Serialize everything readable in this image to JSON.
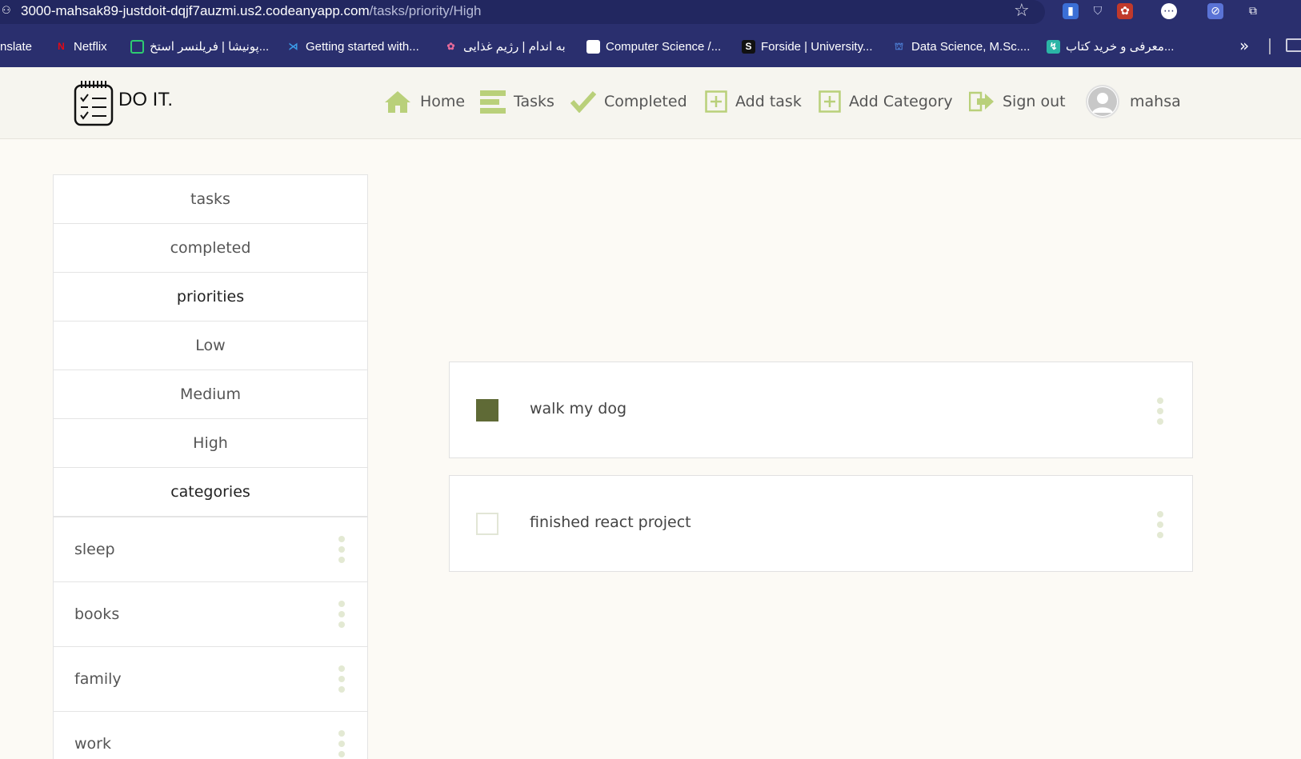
{
  "browser": {
    "url_host": "3000-mahsak89-justdoit-dqjf7auzmi.us2.codeanyapp.com",
    "url_path": "/tasks/priority/High",
    "bookmarks": [
      {
        "label": "nslate"
      },
      {
        "label": "Netflix"
      },
      {
        "label": "پونیشا | فریلنسر استخ..."
      },
      {
        "label": "Getting started with..."
      },
      {
        "label": "به اندام | رژیم غذایی"
      },
      {
        "label": "Computer Science /..."
      },
      {
        "label": "Forside | University..."
      },
      {
        "label": "Data Science, M.Sc...."
      },
      {
        "label": "معرفی و خرید کتاب..."
      }
    ],
    "more_label": "»"
  },
  "app": {
    "brand": "DO IT.",
    "nav": {
      "home": "Home",
      "tasks": "Tasks",
      "completed": "Completed",
      "add_task": "Add task",
      "add_category": "Add Category",
      "sign_out": "Sign out",
      "username": "mahsa"
    }
  },
  "sidebar": {
    "tasks": "tasks",
    "completed": "completed",
    "priorities_header": "priorities",
    "priorities": [
      "Low",
      "Medium",
      "High"
    ],
    "categories_header": "categories",
    "categories": [
      "sleep",
      "books",
      "family",
      "work"
    ]
  },
  "tasks": [
    {
      "title": "walk my dog",
      "completed": true
    },
    {
      "title": "finished react project",
      "completed": false
    }
  ],
  "colors": {
    "accent": "#5f6a36",
    "icon_green": "#b9d07a",
    "browser_bar": "#2a2f6e"
  }
}
